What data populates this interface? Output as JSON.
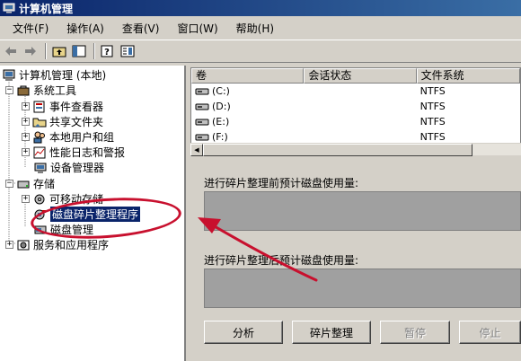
{
  "window": {
    "title": "计算机管理"
  },
  "menu": [
    {
      "label": "文件(F)"
    },
    {
      "label": "操作(A)"
    },
    {
      "label": "查看(V)"
    },
    {
      "label": "窗口(W)"
    },
    {
      "label": "帮助(H)"
    }
  ],
  "tree": {
    "root": "计算机管理 (本地)",
    "system_tools": "系统工具",
    "event_viewer": "事件查看器",
    "shared_folders": "共享文件夹",
    "local_users": "本地用户和组",
    "perf_logs": "性能日志和警报",
    "device_manager": "设备管理器",
    "storage": "存储",
    "removable_storage": "可移动存储",
    "disk_defrag": "磁盘碎片整理程序",
    "disk_management": "磁盘管理",
    "services_apps": "服务和应用程序"
  },
  "volumes": {
    "columns": [
      "卷",
      "会话状态",
      "文件系统"
    ],
    "rows": [
      {
        "volume": "(C:)",
        "session": "",
        "fs": "NTFS"
      },
      {
        "volume": "(D:)",
        "session": "",
        "fs": "NTFS"
      },
      {
        "volume": "(E:)",
        "session": "",
        "fs": "NTFS"
      },
      {
        "volume": "(F:)",
        "session": "",
        "fs": "NTFS"
      }
    ]
  },
  "defrag": {
    "before_label": "进行碎片整理前预计磁盘使用量:",
    "after_label": "进行碎片整理后预计磁盘使用量:",
    "analyze": "分析",
    "defrag": "碎片整理",
    "pause": "暂停",
    "stop": "停止"
  },
  "colors": {
    "title_bar": "#0a246a",
    "annotation": "#c8102e",
    "selection": "#0a246a"
  }
}
